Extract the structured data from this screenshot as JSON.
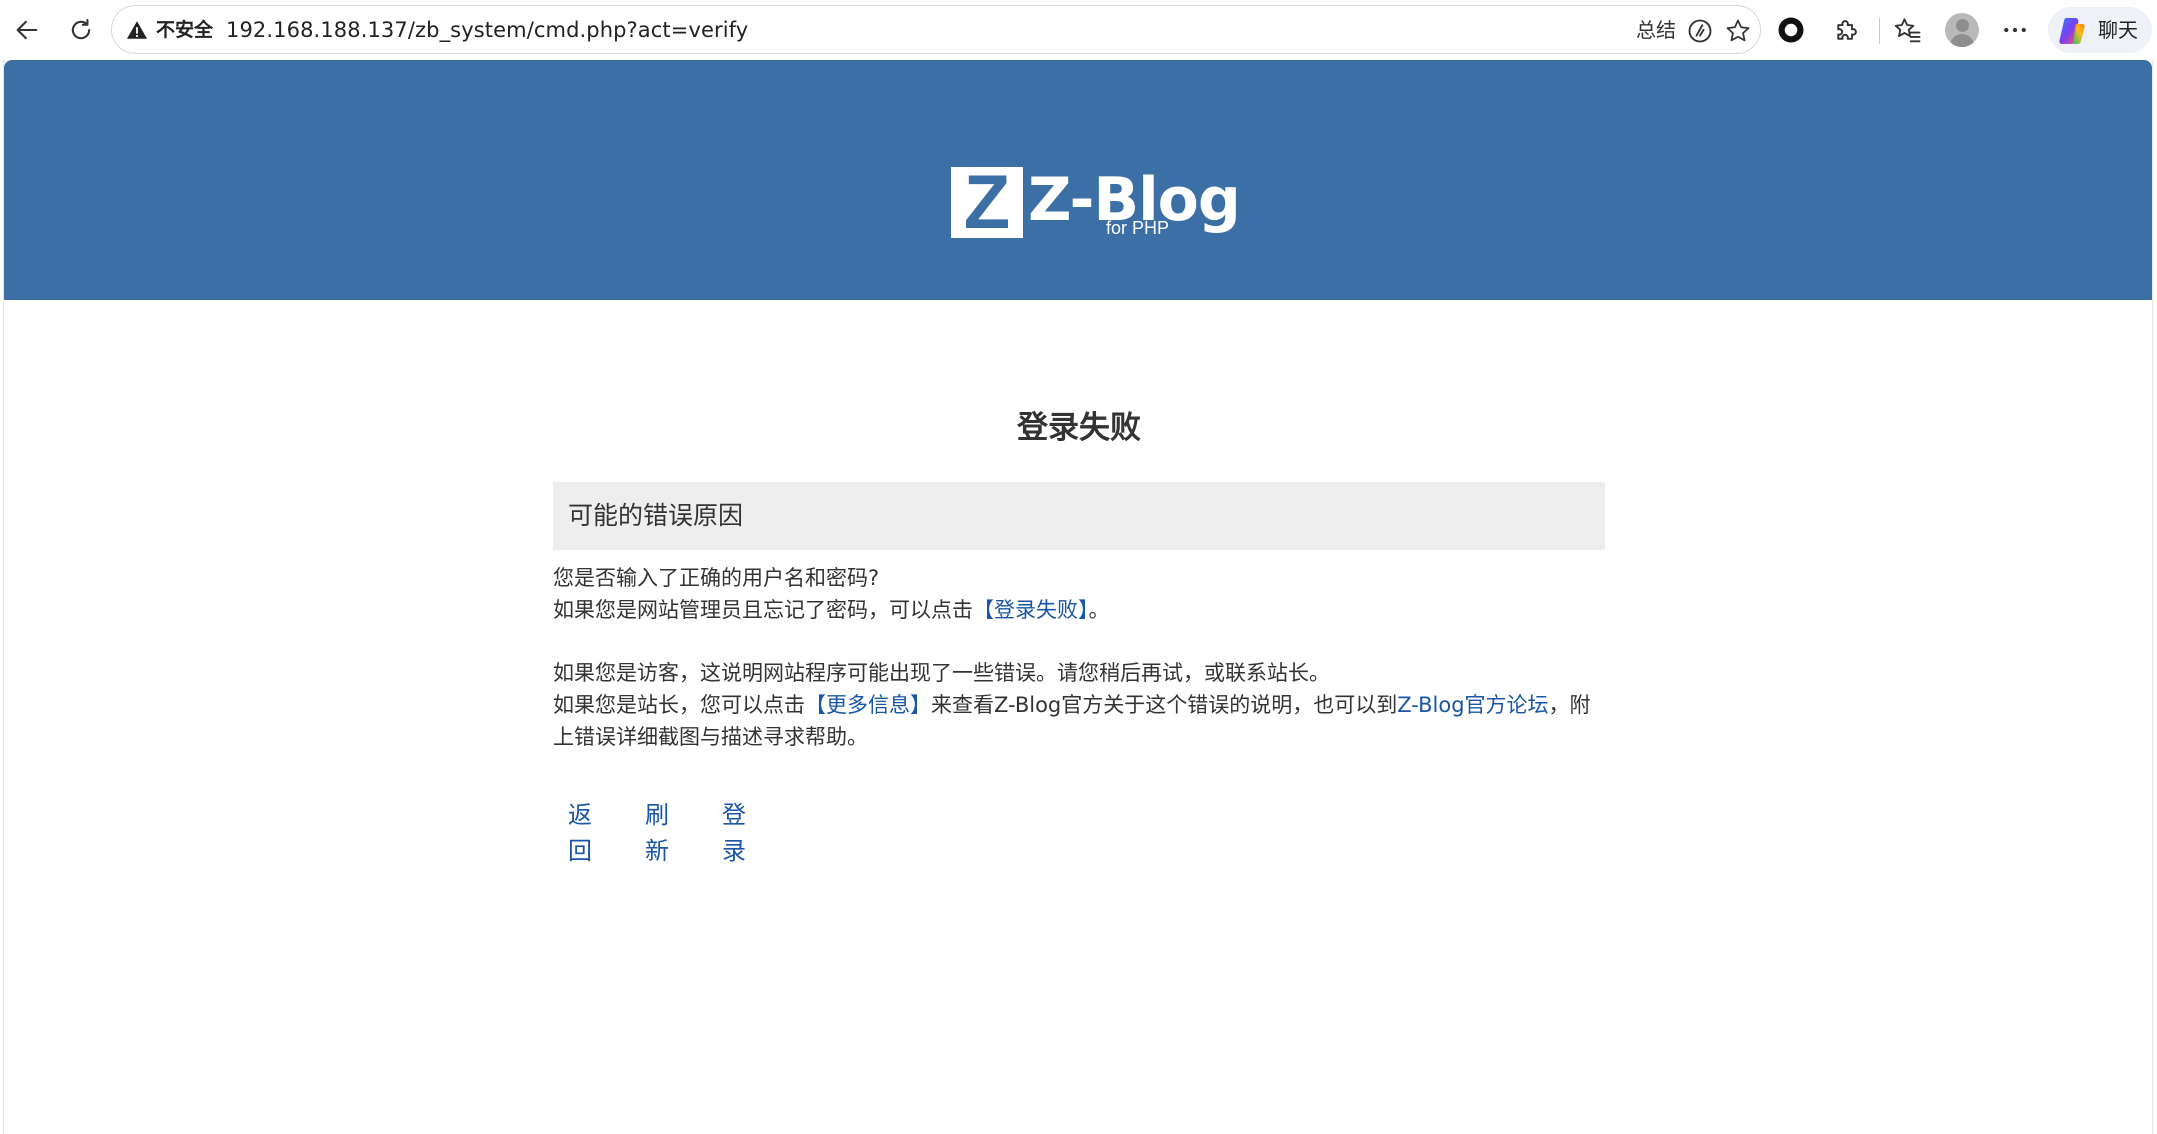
{
  "browser": {
    "insecure_label": "不安全",
    "url": "192.168.188.137/zb_system/cmd.php?act=verify",
    "summary_label": "总结",
    "chat_label": "聊天"
  },
  "header": {
    "logo_letter": "Z",
    "logo_text": "Z-Blog",
    "logo_subtext": "for PHP",
    "background_color": "#3b6fa5"
  },
  "main": {
    "title": "登录失败",
    "reason_title": "可能的错误原因",
    "line1": "您是否输入了正确的用户名和密码?",
    "line2_prefix": "如果您是网站管理员且忘记了密码，可以点击",
    "line2_link": "【登录失败】",
    "line2_suffix": "。",
    "line3": "如果您是访客，这说明网站程序可能出现了一些错误。请您稍后再试，或联系站长。",
    "line4_prefix": "如果您是站长，您可以点击",
    "line4_link1": "【更多信息】",
    "line4_middle": "来查看Z-Blog官方关于这个错误的说明，也可以到",
    "line4_link2": "Z-Blog官方论坛",
    "line4_suffix": "，附",
    "line5": "上错误详细截图与描述寻求帮助。",
    "actions": [
      "返回",
      "刷新",
      "登录"
    ],
    "link_color": "#1a56a6"
  }
}
